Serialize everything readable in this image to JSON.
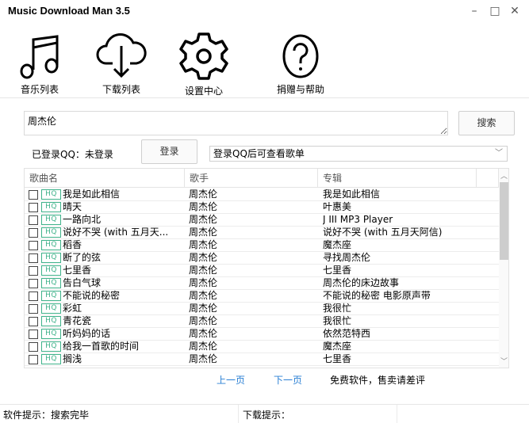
{
  "window": {
    "title": "Music Download Man 3.5",
    "minimize": "–",
    "maximize": "□",
    "close": "✕"
  },
  "toolbar": [
    {
      "label": "音乐列表",
      "icon": "music-note-icon"
    },
    {
      "label": "下载列表",
      "icon": "cloud-download-icon"
    },
    {
      "label": "设置中心",
      "icon": "gear-icon"
    },
    {
      "label": "捐赠与帮助",
      "icon": "help-icon"
    }
  ],
  "search": {
    "value": "周杰伦",
    "button": "搜索"
  },
  "login": {
    "label": "已登录QQ：未登录",
    "button": "登录",
    "playlist_select": "登录QQ后可查看歌单"
  },
  "table": {
    "headers": [
      "歌曲名",
      "歌手",
      "专辑"
    ],
    "badge": "HQ",
    "rows": [
      [
        "我是如此相信",
        "周杰伦",
        "我是如此相信"
      ],
      [
        "晴天",
        "周杰伦",
        "叶惠美"
      ],
      [
        "一路向北",
        "周杰伦",
        "J III MP3 Player"
      ],
      [
        "说好不哭 (with 五月天...",
        "周杰伦",
        "说好不哭 (with 五月天阿信)"
      ],
      [
        "稻香",
        "周杰伦",
        "魔杰座"
      ],
      [
        "断了的弦",
        "周杰伦",
        "寻找周杰伦"
      ],
      [
        "七里香",
        "周杰伦",
        "七里香"
      ],
      [
        "告白气球",
        "周杰伦",
        "周杰伦的床边故事"
      ],
      [
        "不能说的秘密",
        "周杰伦",
        "不能说的秘密 电影原声带"
      ],
      [
        "彩虹",
        "周杰伦",
        "我很忙"
      ],
      [
        "青花瓷",
        "周杰伦",
        "我很忙"
      ],
      [
        "听妈妈的话",
        "周杰伦",
        "依然范特西"
      ],
      [
        "给我一首歌的时间",
        "周杰伦",
        "魔杰座"
      ],
      [
        "搁浅",
        "周杰伦",
        "七里香"
      ]
    ]
  },
  "pagination": {
    "prev": "上一页",
    "next": "下一页",
    "notice": "免费软件，售卖请差评"
  },
  "status": {
    "software": "软件提示：搜索完毕",
    "download": "下载提示："
  },
  "colors": {
    "hq_badge": "#3fb28a",
    "link": "#2a7fd4"
  }
}
